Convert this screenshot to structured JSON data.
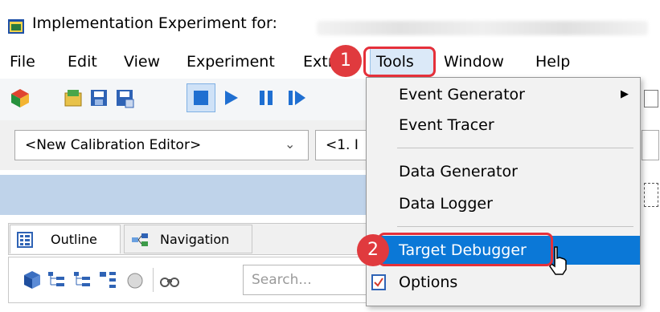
{
  "window": {
    "title": "Implementation Experiment for:"
  },
  "menu": {
    "items": [
      "File",
      "Edit",
      "View",
      "Experiment",
      "Extras",
      "Tools",
      "Window",
      "Help"
    ]
  },
  "combos": {
    "calibration_editor": "<New Calibration Editor>",
    "second": "<1. I"
  },
  "panel": {
    "tab_outline": "Outline",
    "tab_navigation": "Navigation",
    "search_placeholder": "Search..."
  },
  "tools_menu": {
    "event_generator": "Event Generator",
    "event_tracer": "Event Tracer",
    "data_generator": "Data Generator",
    "data_logger": "Data Logger",
    "target_debugger": "Target Debugger",
    "options": "Options"
  },
  "callouts": {
    "one": "1",
    "two": "2"
  },
  "colors": {
    "highlight": "#0b78d7",
    "callout_red": "#e03a3e",
    "blue_band": "#bfd3ea"
  }
}
